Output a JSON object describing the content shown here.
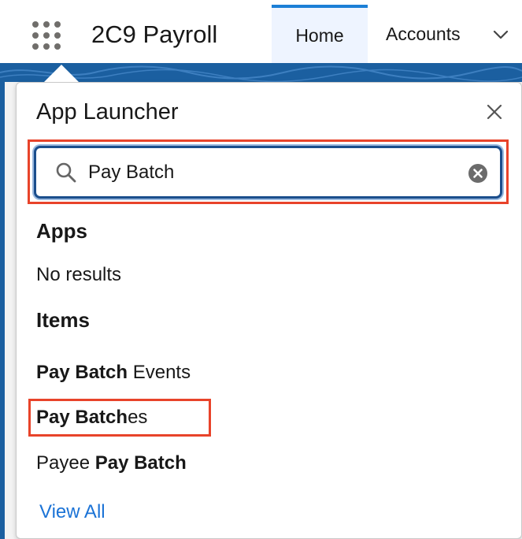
{
  "header": {
    "app_name": "2C9 Payroll",
    "tabs": [
      {
        "label": "Home",
        "active": true
      },
      {
        "label": "Accounts",
        "active": false
      }
    ]
  },
  "launcher": {
    "title": "App Launcher",
    "search": {
      "value": "Pay Batch"
    },
    "apps": {
      "heading": "Apps",
      "empty_text": "No results"
    },
    "items": {
      "heading": "Items",
      "list": [
        {
          "match": "Pay Batch",
          "rest_before": "",
          "rest_after": " Events"
        },
        {
          "match": "Pay Batch",
          "rest_before": "",
          "rest_after": "es"
        },
        {
          "match": "Pay Batch",
          "rest_before": "Payee ",
          "rest_after": ""
        }
      ]
    },
    "view_all": "View All"
  },
  "colors": {
    "accent": "#1b73d6",
    "highlight_box": "#e8432a",
    "brand_band": "#1b5fa0"
  }
}
